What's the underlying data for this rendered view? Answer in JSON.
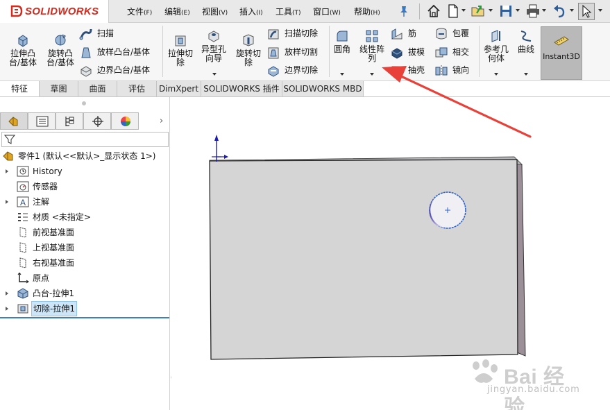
{
  "app": {
    "brand": "SOLIDWORKS"
  },
  "menu": [
    {
      "label": "文件",
      "accel": "(F)"
    },
    {
      "label": "编辑",
      "accel": "(E)"
    },
    {
      "label": "视图",
      "accel": "(V)"
    },
    {
      "label": "插入",
      "accel": "(I)"
    },
    {
      "label": "工具",
      "accel": "(T)"
    },
    {
      "label": "窗口",
      "accel": "(W)"
    },
    {
      "label": "帮助",
      "accel": "(H)"
    }
  ],
  "ribbon": {
    "extrude_boss": "拉伸凸\n台/基体",
    "revolve_boss": "旋转凸\n台/基体",
    "sweep": "扫描",
    "loft_boss": "放样凸台/基体",
    "boundary_boss": "边界凸台/基体",
    "extrude_cut": "拉伸切\n除",
    "hole_wizard": "异型孔\n向导",
    "revolve_cut": "旋转切\n除",
    "sweep_cut": "扫描切除",
    "loft_cut": "放样切割",
    "boundary_cut": "边界切除",
    "fillet": "圆角",
    "linear_pattern": "线性阵\n列",
    "rib": "筋",
    "draft": "拔模",
    "shell": "抽壳",
    "wrap": "包覆",
    "intersect": "相交",
    "mirror": "镜向",
    "ref_geometry": "参考几\n何体",
    "curves": "曲线",
    "instant3d": "Instant3D"
  },
  "tabs": [
    "特征",
    "草图",
    "曲面",
    "评估",
    "DimXpert",
    "SOLIDWORKS 插件",
    "SOLIDWORKS MBD"
  ],
  "tree": {
    "root": "零件1  (默认<<默认>_显示状态 1>)",
    "items": [
      {
        "label": "History",
        "expandable": true,
        "icon": "history-icon"
      },
      {
        "label": "传感器",
        "expandable": false,
        "icon": "sensor-icon"
      },
      {
        "label": "注解",
        "expandable": true,
        "icon": "annotation-icon"
      },
      {
        "label": "材质 <未指定>",
        "expandable": false,
        "icon": "material-icon"
      },
      {
        "label": "前视基准面",
        "expandable": false,
        "icon": "plane-icon"
      },
      {
        "label": "上视基准面",
        "expandable": false,
        "icon": "plane-icon"
      },
      {
        "label": "右视基准面",
        "expandable": false,
        "icon": "plane-icon"
      },
      {
        "label": "原点",
        "expandable": false,
        "icon": "origin-icon"
      },
      {
        "label": "凸台-拉伸1",
        "expandable": true,
        "icon": "extrude-feature-icon"
      },
      {
        "label": "切除-拉伸1",
        "expandable": true,
        "icon": "cut-feature-icon",
        "selected": true
      }
    ]
  },
  "watermark": {
    "text": "Bai 经验",
    "url": "jingyan.baidu.com"
  },
  "colors": {
    "brand_red": "#d52b1e",
    "annotation_arrow": "#e8413a",
    "selection_blue": "#cde6f7"
  }
}
